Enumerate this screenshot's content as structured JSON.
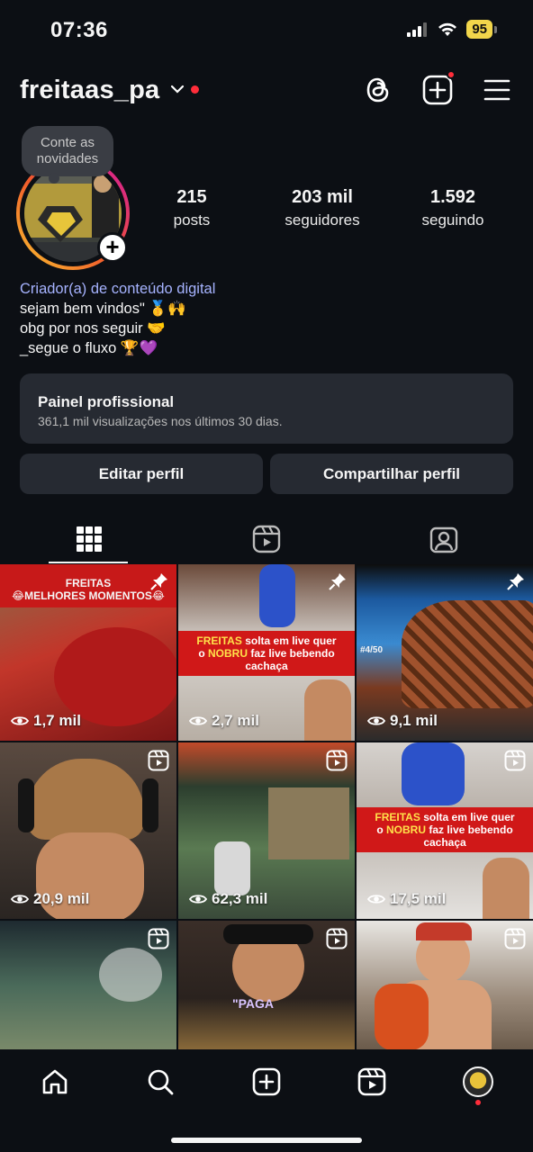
{
  "status_bar": {
    "time": "07:36",
    "battery": "95"
  },
  "header": {
    "username": "freitaas_pa"
  },
  "profile": {
    "note": "Conte as novidades",
    "stats": [
      {
        "value": "215",
        "label": "posts"
      },
      {
        "value": "203 mil",
        "label": "seguidores"
      },
      {
        "value": "1.592",
        "label": "seguindo"
      }
    ],
    "category": "Criador(a) de conteúdo digital",
    "bio_lines": [
      "sejam bem vindos\" 🥇🙌",
      "obg por nos seguir 🤝",
      "_segue o fluxo 🏆💜"
    ]
  },
  "dashboard": {
    "title": "Painel profissional",
    "subtitle": "361,1 mil visualizações nos últimos 30 dias."
  },
  "buttons": {
    "edit": "Editar perfil",
    "share": "Compartilhar perfil"
  },
  "grid": {
    "posts": [
      {
        "views": "1,7 mil",
        "type": "pinned",
        "banner_top": "FREITAS",
        "banner_bottom": "😂MELHORES MOMENTOS😂"
      },
      {
        "views": "2,7 mil",
        "type": "pinned",
        "banner_line1_a": "FREITAS",
        "banner_line1_b": " solta em live quer",
        "banner_line2_a": "o ",
        "banner_line2_b": "NOBRU",
        "banner_line2_c": " faz live bebendo",
        "banner_line3": "cachaça"
      },
      {
        "views": "9,1 mil",
        "type": "pinned",
        "hud": "#4/50"
      },
      {
        "views": "20,9 mil",
        "type": "reel"
      },
      {
        "views": "62,3 mil",
        "type": "reel"
      },
      {
        "views": "17,5 mil",
        "type": "reel",
        "banner_line1_a": "FREITAS",
        "banner_line1_b": " solta em live quer",
        "banner_line2_a": "o ",
        "banner_line2_b": "NOBRU",
        "banner_line2_c": " faz live bebendo",
        "banner_line3": "cachaça"
      },
      {
        "views": "",
        "type": "reel"
      },
      {
        "views": "",
        "type": "reel",
        "caption": "\"PAGA"
      },
      {
        "views": "",
        "type": "reel"
      }
    ]
  },
  "colors": {
    "background": "#0c0f14",
    "surface": "#262a32",
    "accent": "#a6b3ff",
    "notification": "#ff2d3a"
  }
}
